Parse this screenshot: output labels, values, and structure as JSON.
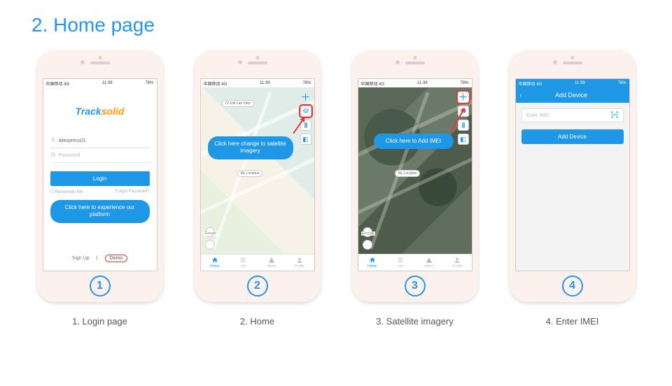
{
  "page": {
    "title": "2. Home page"
  },
  "status": {
    "left_carrier": "中国移动 4G",
    "time": "11:39",
    "right_batt": "78%"
  },
  "screen1": {
    "logo_a": "Track",
    "logo_b": "solid",
    "username": "aliexpress01",
    "password_placeholder": "Password",
    "login_btn": "Login",
    "remember": "Remember Me",
    "forgot": "Forgot Password?",
    "callout": "Click here to experience our platform",
    "signup": "Sign Up",
    "demo": "Demo"
  },
  "screen2": {
    "callout": "Click here change to satellite imagery",
    "my_location": "My Location",
    "poi1": "72 chế Lan Viên",
    "google": "Google"
  },
  "screen3": {
    "callout": "Click here to Add IMEI",
    "my_location": "My Location",
    "google": "Google"
  },
  "screen4": {
    "nav_title": "Add Device",
    "imei_placeholder": "Enter IMEI",
    "add_btn": "Add Device"
  },
  "tabs": [
    "Home",
    "List",
    "Alerts",
    "Profile"
  ],
  "captions": {
    "c1": "1. Login page",
    "c2": "2. Home",
    "c3": "3. Satellite imagery",
    "c4": "4. Enter IMEI"
  },
  "numbers": {
    "n1": "1",
    "n2": "2",
    "n3": "3",
    "n4": "4"
  }
}
